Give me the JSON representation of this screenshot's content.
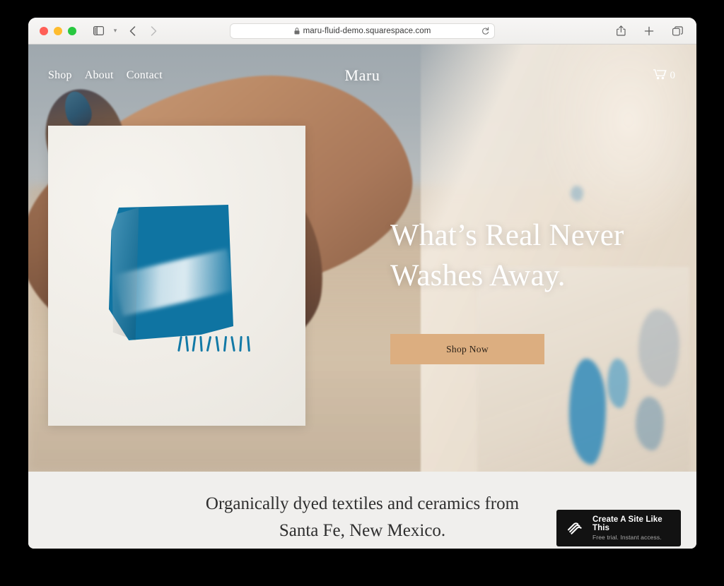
{
  "browser": {
    "url": "maru-fluid-demo.squarespace.com",
    "traffic_lights": [
      "close",
      "minimize",
      "zoom"
    ],
    "toolbar_icons": [
      "sidebar-toggle",
      "chevron-down",
      "back-arrow",
      "forward-arrow",
      "lock",
      "reload",
      "share",
      "new-tab",
      "tab-overview"
    ],
    "colors": {
      "close": "#ff5f57",
      "minimize": "#febc2e",
      "zoom": "#28c840",
      "chrome_bg": "#f2f1ef"
    }
  },
  "site": {
    "brand": "Maru",
    "nav": [
      {
        "label": "Shop"
      },
      {
        "label": "About"
      },
      {
        "label": "Contact"
      }
    ],
    "cart": {
      "icon": "shopping-cart-icon",
      "count": "0"
    },
    "hero": {
      "headline_line1": "What’s Real Never",
      "headline_line2": "Washes Away.",
      "cta_label": "Shop Now",
      "cta_color": "#dcae80",
      "product_image_alt": "indigo shibori dyed textile"
    },
    "tagline_line1": "Organically dyed textiles and ceramics from",
    "tagline_line2": "Santa Fe, New Mexico."
  },
  "badge": {
    "logo": "squarespace-logo",
    "title": "Create A Site Like This",
    "subtitle": "Free trial. Instant access.",
    "bg": "#121212"
  }
}
